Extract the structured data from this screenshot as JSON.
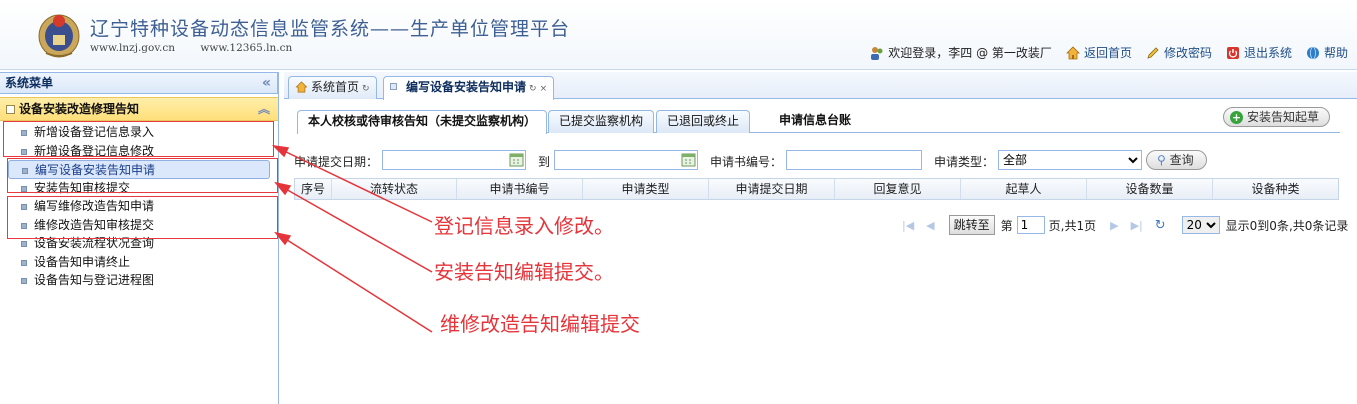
{
  "header": {
    "title": "辽宁特种设备动态信息监管系统——生产单位管理平台",
    "sites": [
      "www.lnzj.gov.cn",
      "www.12365.ln.cn"
    ],
    "welcome": "欢迎登录，李四 @ 第一改装厂",
    "links": {
      "home": "返回首页",
      "password": "修改密码",
      "logout": "退出系统",
      "help": "帮助"
    }
  },
  "sidebar": {
    "title": "系统菜单",
    "collapse_glyph": "«",
    "group": {
      "title": "设备安装改造修理告知",
      "toggle_glyph": "︽"
    },
    "items": [
      {
        "label": "新增设备登记信息录入"
      },
      {
        "label": "新增设备登记信息修改"
      },
      {
        "label": "编写设备安装告知申请"
      },
      {
        "label": "安装告知审核提交"
      },
      {
        "label": "编写维修改造告知申请"
      },
      {
        "label": "维修改造告知审核提交"
      },
      {
        "label": "设备安装流程状况查询"
      },
      {
        "label": "设备告知申请终止"
      },
      {
        "label": "设备告知与登记进程图"
      }
    ]
  },
  "tabs": [
    {
      "label": "系统首页"
    },
    {
      "label": "编写设备安装告知申请"
    }
  ],
  "subtabs": [
    {
      "label": "本人校核或待审核告知（未提交监察机构）"
    },
    {
      "label": "已提交监察机构"
    },
    {
      "label": "已退回或终止"
    },
    {
      "label": "申请信息台账"
    }
  ],
  "start_button": "安装告知起草",
  "filters": {
    "date_label": "申请提交日期：",
    "to_label": "到",
    "number_label": "申请书编号：",
    "type_label": "申请类型：",
    "type_value": "全部",
    "query_button": "查询"
  },
  "grid": {
    "columns": [
      "序号",
      "流转状态",
      "申请书编号",
      "申请类型",
      "申请提交日期",
      "回复意见",
      "起草人",
      "设备数量",
      "设备种类"
    ]
  },
  "pager": {
    "jump_button": "跳转至",
    "page_prefix": "第",
    "page_value": "1",
    "page_suffix": "页,共1页",
    "page_size": "20",
    "summary": "显示0到0条,共0条记录"
  },
  "annotations": [
    "登记信息录入修改。",
    "安装告知编辑提交。",
    "维修改造告知编辑提交"
  ],
  "colors": {
    "annotation": "#e5343a",
    "accent": "#95b8e7",
    "group": "#ffdf7a"
  }
}
